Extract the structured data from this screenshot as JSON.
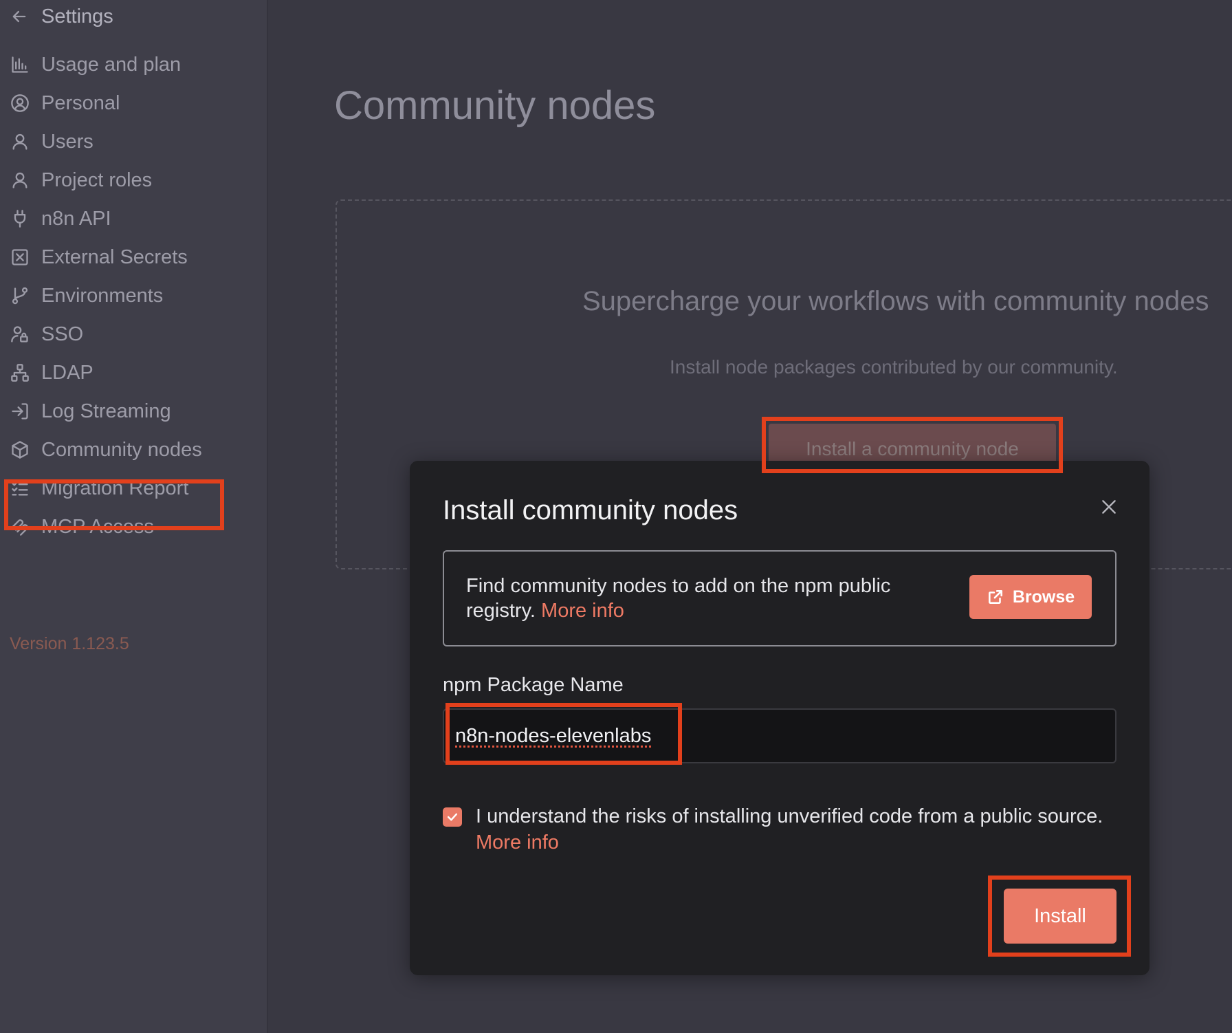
{
  "sidebar": {
    "back_label": "Settings",
    "items": [
      {
        "label": "Usage and plan",
        "icon": "chart-bar-icon"
      },
      {
        "label": "Personal",
        "icon": "user-circle-icon"
      },
      {
        "label": "Users",
        "icon": "user-icon"
      },
      {
        "label": "Project roles",
        "icon": "user-icon"
      },
      {
        "label": "n8n API",
        "icon": "plug-icon"
      },
      {
        "label": "External Secrets",
        "icon": "vault-icon"
      },
      {
        "label": "Environments",
        "icon": "git-branch-icon"
      },
      {
        "label": "SSO",
        "icon": "user-lock-icon"
      },
      {
        "label": "LDAP",
        "icon": "network-icon"
      },
      {
        "label": "Log Streaming",
        "icon": "sign-in-icon"
      },
      {
        "label": "Community nodes",
        "icon": "cube-icon"
      },
      {
        "label": "Migration Report",
        "icon": "list-checks-icon"
      },
      {
        "label": "MCP Access",
        "icon": "mcp-icon"
      }
    ],
    "version": "Version 1.123.5"
  },
  "main": {
    "title": "Community nodes",
    "hero_title": "Supercharge your workflows with community nodes",
    "hero_subtitle": "Install node packages contributed by our community.",
    "install_cta": "Install a community node"
  },
  "modal": {
    "title": "Install community nodes",
    "info_text": "Find community nodes to add on the npm public registry.",
    "info_link": "More info",
    "browse_label": "Browse",
    "field_label": "npm Package Name",
    "package_value": "n8n-nodes-elevenlabs",
    "risk_text": "I understand the risks of installing unverified code from a public source.",
    "risk_link": "More info",
    "risk_checked": true,
    "install_label": "Install"
  },
  "colors": {
    "accent": "#ea7a66",
    "highlight": "#e2401c",
    "modal_bg": "#202023",
    "page_bg": "#393842"
  }
}
